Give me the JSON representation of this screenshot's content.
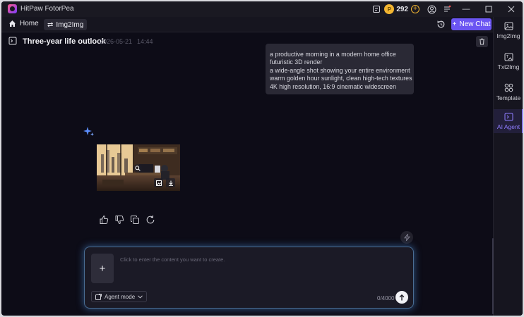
{
  "app": {
    "title": "HitPaw FotorPea"
  },
  "titlebar": {
    "coins": "292"
  },
  "toolbar": {
    "home_label": "Home",
    "crumb_label": "Img2Img",
    "new_chat_label": "New Chat"
  },
  "sidebar": {
    "items": [
      {
        "label": "Img2Img",
        "icon": "image-icon"
      },
      {
        "label": "Txt2Img",
        "icon": "text-image-icon"
      },
      {
        "label": "Template",
        "icon": "template-icon"
      },
      {
        "label": "AI Agent",
        "icon": "ai-agent-icon",
        "active": true
      }
    ]
  },
  "chat": {
    "title": "Three-year life outlook",
    "date": "2026-05-21",
    "time": "14:44",
    "user_message_lines": [
      "a productive morning in a modern home office",
      "futuristic 3D render",
      "a wide-angle shot showing your entire environment",
      "warm golden hour sunlight, clean high-tech textures",
      "4K high resolution, 16:9 cinematic widescreen"
    ]
  },
  "input": {
    "placeholder": "Click to enter the content you want to create.",
    "mode_label": "Agent mode",
    "counter": "0/4000"
  },
  "colors": {
    "accent": "#6b55f2",
    "background": "#0d0c17",
    "panel": "#16151f",
    "glow": "#4a6d93"
  }
}
